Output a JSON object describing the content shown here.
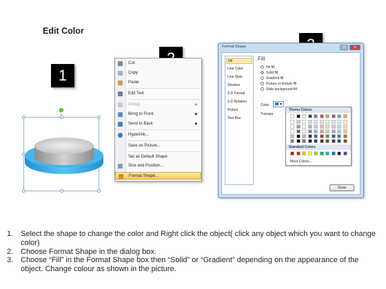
{
  "title": "Edit Color",
  "badges": [
    "1",
    "2",
    "3"
  ],
  "context_menu": {
    "items": [
      {
        "label": "Cut",
        "icon": "scissors-icon",
        "disabled": false
      },
      {
        "label": "Copy",
        "icon": "copy-icon",
        "disabled": false
      },
      {
        "label": "Paste",
        "icon": "paste-icon",
        "disabled": false
      },
      {
        "label": "Edit Text",
        "icon": "edit-text-icon",
        "disabled": false
      },
      {
        "label": "Group",
        "icon": "group-icon",
        "disabled": true,
        "submenu": true
      },
      {
        "label": "Bring to Front",
        "icon": "bring-front-icon",
        "disabled": false,
        "submenu": true
      },
      {
        "label": "Send to Back",
        "icon": "send-back-icon",
        "disabled": false,
        "submenu": true
      },
      {
        "label": "Hyperlink...",
        "icon": "hyperlink-icon",
        "disabled": false
      },
      {
        "label": "Save as Picture...",
        "icon": "",
        "disabled": false
      },
      {
        "label": "Set as Default Shape",
        "icon": "",
        "disabled": false
      },
      {
        "label": "Size and Position...",
        "icon": "size-icon",
        "disabled": false
      },
      {
        "label": "Format Shape...",
        "icon": "format-icon",
        "disabled": false,
        "active": true
      }
    ]
  },
  "dialog": {
    "title": "Format Shape",
    "categories": [
      "Fill",
      "Line Color",
      "Line Style",
      "Shadow",
      "3-D Format",
      "3-D Rotation",
      "Picture",
      "Text Box"
    ],
    "pane_title": "Fill",
    "options": [
      "No fill",
      "Solid fill",
      "Gradient fill",
      "Picture or texture fill",
      "Slide background fill"
    ],
    "color_label": "Color:",
    "transparency_label": "Transpa",
    "close_label": "Close",
    "palette": {
      "theme_title": "Theme Colors",
      "standard_title": "Standard Colors",
      "more_label": "More Colors...",
      "theme_top": [
        "#ffffff",
        "#000000",
        "#eeece1",
        "#1f497d",
        "#4f81bd",
        "#c0504d",
        "#9bbb59",
        "#8064a2",
        "#4bacc6",
        "#f79646"
      ],
      "standard": [
        "#c00000",
        "#ff0000",
        "#ffc000",
        "#ffff00",
        "#92d050",
        "#00b050",
        "#00b0f0",
        "#0070c0",
        "#002060",
        "#7030a0"
      ]
    }
  },
  "steps": [
    {
      "num": "1.",
      "text": "Select the shape to change the color and Right click the object( click any object which you want to change color)"
    },
    {
      "num": "2.",
      "text": "Choose Format Shape in the dialog box."
    },
    {
      "num": "3.",
      "text": "Choose “Fill” in the Format Shape box then “Solid” or “Gradient” depending on the appearance of the object. Change colour as shown in the picture."
    }
  ]
}
